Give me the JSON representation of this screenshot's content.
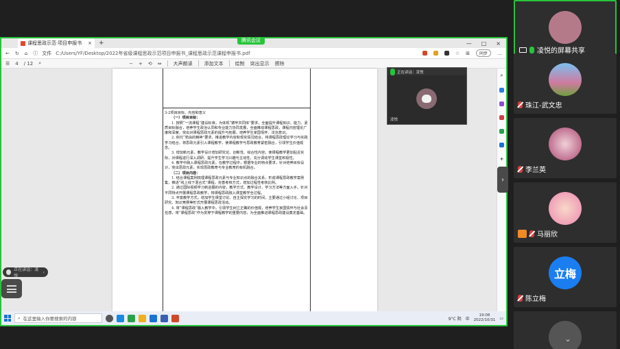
{
  "share_tag": "腾讯会议",
  "browser": {
    "tab_title": "课程思政示范·项目申报书",
    "new_tab": "+",
    "address_label": "文件",
    "url": "C:/Users/YF/Desktop/2022年省级课程思政示范项目申报书_课程思政示范课程申报书.pdf",
    "sync_label": "同步"
  },
  "pdf_toolbar": {
    "page_current": "4",
    "page_total": "/ 12",
    "zoom_out": "−",
    "zoom_in": "+",
    "read_aloud": "大声朗读",
    "add_text": "添加文本",
    "draw": "绘制",
    "highlight": "突出显示",
    "erase": "擦除"
  },
  "document": {
    "section_title": "3-2项目目标、内容和意义",
    "goals_heading": "（一）项目目标：",
    "goals": [
      "1. 按照“一流课程”建设标准，为体现“铸牢共同体”要求，全面提升课程知识、能力、素质目标融合，培养学生政治认同和专业能力协同发展，全面推动课程思政，课程内容理论广度和深度，突出对课程思政元素的提升与拓展，培养学生家国情怀、法治意识。",
      "2. 依托“党由的精神”要求，推进教学内容和现实情况结合，将课程思政理论学习与实践学习结合，将思政元素引入课程教学，使课程教学与思政教育紧密融合，引领学生价值观念。",
      "3. 增加新元素，教学设计增加研究论、创新性、综合性内容，使课程教学更加贴近实际，对课程进行深入调研、提升学生学习兴趣与主动性，充分调动学生课堂积极性。",
      "4. 教学中融入课程思政元素，在教学过程中，根据专业的特点要求，针对培养目标设计，突出思政元素，实现思政教育与专业教育的有机融合。"
    ],
    "content_heading": "（二）项目内容：",
    "content": [
      "1. 结合课程案例梳理课程思政元素与专业知识点的融合关系，形成课程思政教学案例集，推进“线上线下混合式”课程，完善考核方式，增加过程性考核比例。",
      "2. 通过国际视频学习新进展的内容，教学方式、教学设计、学习方法等方面入手。针对不同特点开展课程思政教学，将课程思政融入课堂教学全过程。",
      "3. 丰富教学方式，增加学生课堂讨论、自主探究学习的时间，主要通过小组讨论、项目研究、知识竞赛等形式开展课程思政活动。",
      "4. 将“课程思政”融入教学中，引领学生树立正确的价值观，培养学生家国情怀与社会责任感，将“课程思政”作为贯穿于课程教学的重要内容，为全面推进课程思政建设奠定基础。"
    ]
  },
  "mini_window": {
    "title": "正在讲话：凌悦",
    "label": "凌悦"
  },
  "taskbar": {
    "search_placeholder": "在这里输入你要搜索的内容",
    "weather": "9°C 阴",
    "ime": "中",
    "time": "19:08",
    "date": "2022/10/31"
  },
  "left_controls": {
    "speaker_label": "正在讲话：凌悦"
  },
  "participants": [
    {
      "name": "凌悦的屏幕共享",
      "type": "screen"
    },
    {
      "name": "珠江-武文忠",
      "type": "muted"
    },
    {
      "name": "李兰英",
      "type": "muted"
    },
    {
      "name": "马丽欣",
      "type": "host"
    },
    {
      "name": "陈立梅",
      "type": "muted",
      "initials": "立梅"
    }
  ],
  "colors": {
    "accent_green": "#27c43a",
    "muted_red": "#e04040",
    "initial_blue": "#1a7ef0"
  }
}
